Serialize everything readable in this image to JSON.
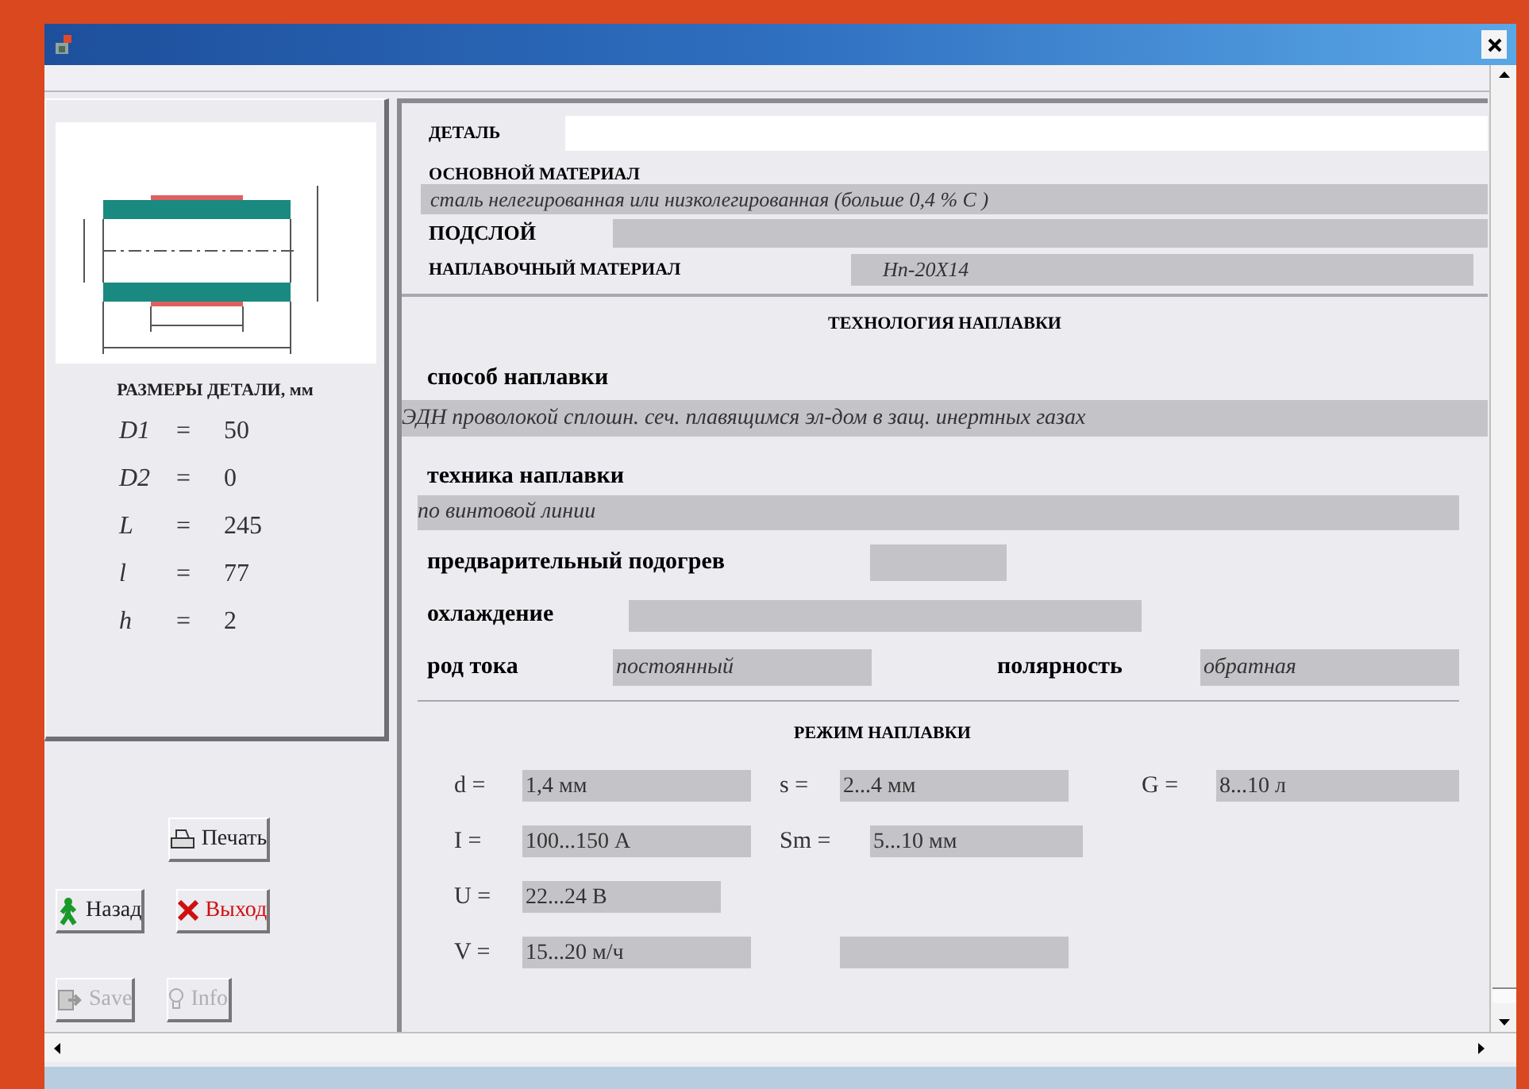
{
  "dimensions": {
    "title": "РАЗМЕРЫ ДЕТАЛИ, мм",
    "items": [
      {
        "symbol": "D1",
        "sign": "=",
        "value": "50"
      },
      {
        "symbol": "D2",
        "sign": "=",
        "value": "0"
      },
      {
        "symbol": "L",
        "sign": "=",
        "value": "245"
      },
      {
        "symbol": "l",
        "sign": "=",
        "value": "77"
      },
      {
        "symbol": "h",
        "sign": "=",
        "value": "2"
      }
    ]
  },
  "buttons": [
    {
      "label": "Печать",
      "kind": "print",
      "disabled": false
    },
    {
      "label": "Назад",
      "kind": "back",
      "disabled": false
    },
    {
      "label": "Выход",
      "kind": "exit",
      "disabled": false
    },
    {
      "label": "Save",
      "kind": "save",
      "disabled": true
    },
    {
      "label": "Info",
      "kind": "info",
      "disabled": true
    }
  ],
  "material": {
    "part_label": "ДЕТАЛЬ",
    "base_label": "ОСНОВНОЙ МАТЕРИАЛ",
    "base_value": "сталь нелегированная или низколегированная (больше 0,4 % С )",
    "sublayer_label": "ПОДСЛОЙ",
    "filler_label": "НАПЛАВОЧНЫЙ МАТЕРИАЛ",
    "filler_value": "Нп-20Х14"
  },
  "technology": {
    "title": "ТЕХНОЛОГИЯ НАПЛАВКИ",
    "method_label": "способ наплавки",
    "method_value": "ЭДН проволокой сплошн. сеч. плавящимся эл-дом в защ. инертных газах",
    "technique_label": "техника наплавки",
    "technique_value": "по винтовой линии",
    "preheat_label": "предварительный подогрев",
    "cooling_label": "охлаждение",
    "current_label": "род тока",
    "current_value": "постоянный",
    "polarity_label": "полярность",
    "polarity_value": "обратная"
  },
  "mode": {
    "title": "РЕЖИМ НАПЛАВКИ",
    "rows": [
      [
        {
          "kind": "param",
          "symbol": "d =",
          "value": "1,4 мм"
        },
        {
          "kind": "param",
          "symbol": "s =",
          "value": "2...4 мм"
        },
        {
          "kind": "param",
          "symbol": "G =",
          "value": "8...10 л"
        }
      ],
      [
        {
          "kind": "param",
          "symbol": "I =",
          "value": "100...150 А"
        },
        {
          "kind": "param",
          "symbol": "Sm =",
          "value": "5...10 мм"
        }
      ],
      [
        {
          "kind": "param",
          "symbol": "U =",
          "value": "22...24 В"
        }
      ],
      [
        {
          "kind": "param",
          "symbol": "V =",
          "value": "15...20 м/ч"
        },
        {
          "kind": "empty"
        }
      ]
    ]
  }
}
